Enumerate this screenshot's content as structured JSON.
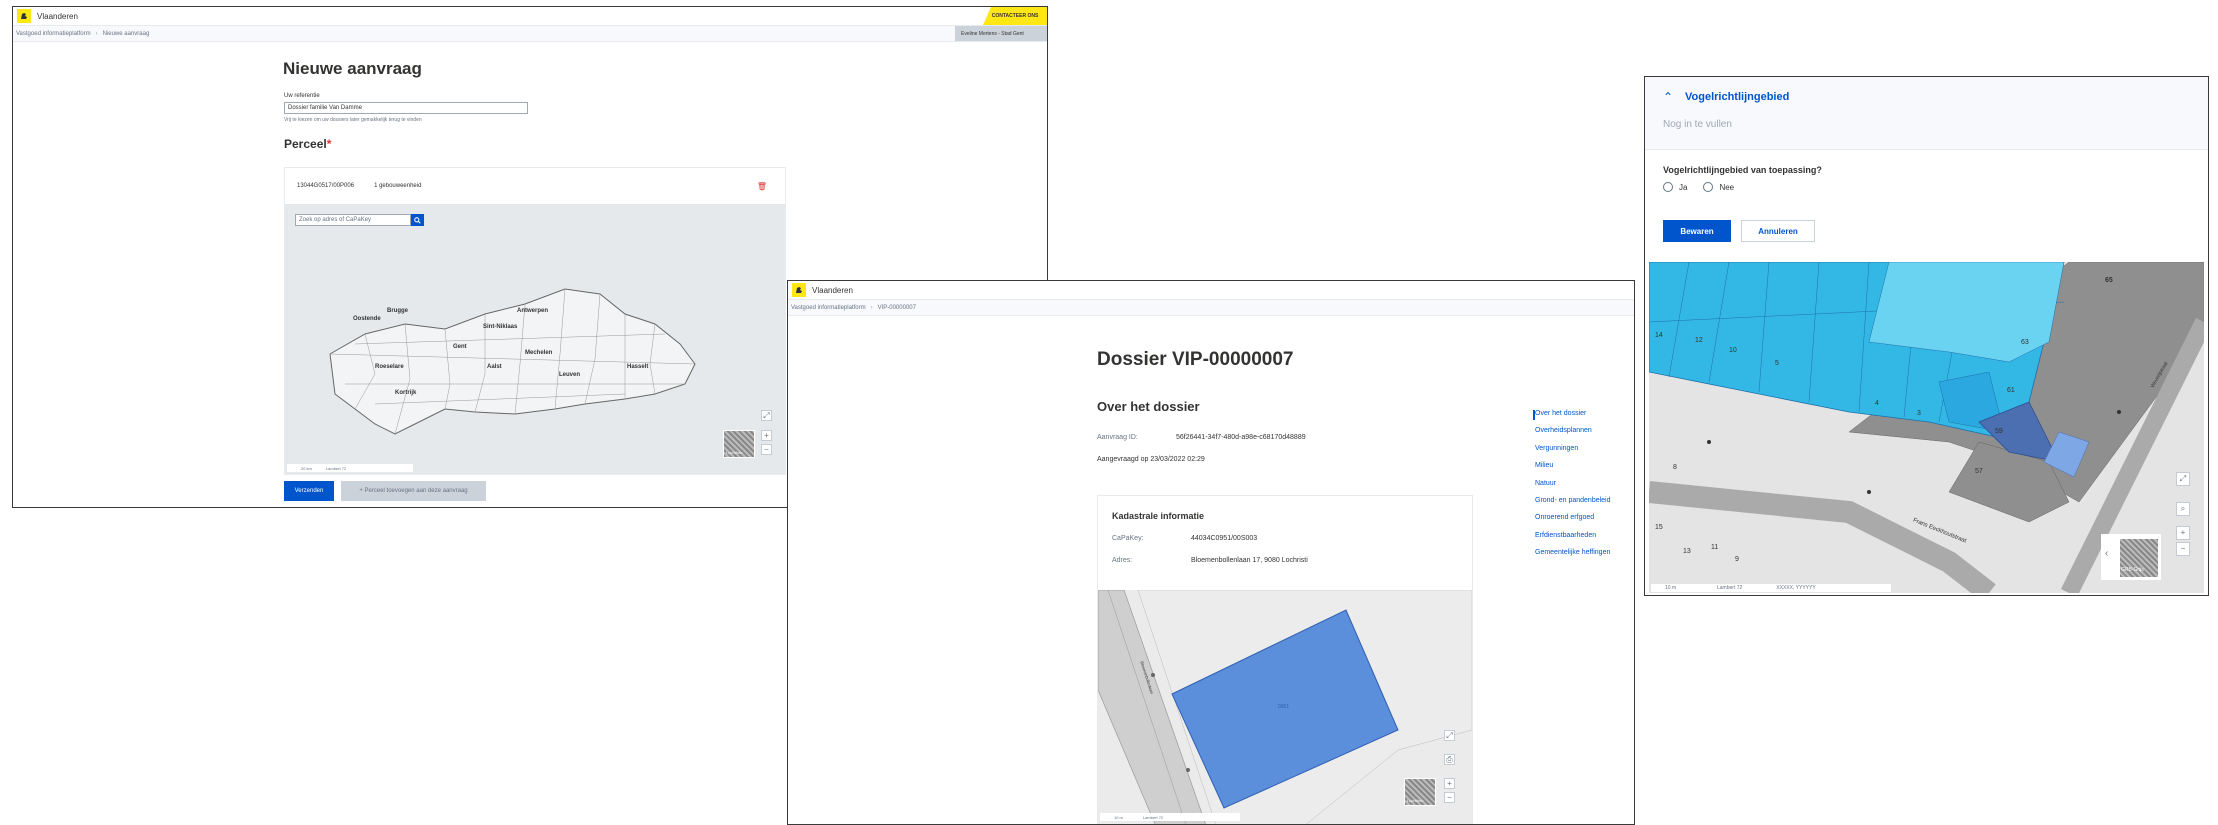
{
  "window1": {
    "brand": "Vlaanderen",
    "contact_label": "CONTACTEER ONS",
    "user_label": "Eveline Mertens - Stad Gent",
    "breadcrumb": [
      "Vastgoed informatieplatform",
      "Nieuwe aanvraag"
    ],
    "title": "Nieuwe aanvraag",
    "reference_label": "Uw referentie",
    "reference_value": "Dossier familie Van Damme",
    "reference_hint": "Vrij te kiezen om uw dossiers later gemakkelijk terug te vinden",
    "perceel_label": "Perceel",
    "perceel_required": "*",
    "parcel_id": "13044G0517/00P006",
    "parcel_units": "1 gebouweenheid",
    "search_placeholder": "Zoek op adres of CaPaKey",
    "map_cities": [
      "Oostende",
      "Brugge",
      "Gent",
      "Sint-Niklaas",
      "Antwerpen",
      "Mechelen",
      "Aalst",
      "Roeselare",
      "Kortrijk",
      "Leuven",
      "Hasselt"
    ],
    "scale_text": "20 km",
    "projection": "Lambert 72",
    "thumb_label": "Luchtfoto",
    "submit_label": "Verzenden",
    "add_parcel_label": "+ Perceel toevoegen aan deze aanvraag"
  },
  "window2": {
    "brand": "Vlaanderen",
    "breadcrumb": [
      "Vastgoed informatieplatform",
      "VIP-00000007"
    ],
    "title": "Dossier VIP-00000007",
    "section_title": "Over het dossier",
    "request_id_label": "Aanvraag ID:",
    "request_id_value": "56f26441-34f7-480d-a98e-c68170d48889",
    "requested_on": "Aangevraagd op 23/03/2022 02:29",
    "cadastral_title": "Kadastrale informatie",
    "capakey_label": "CaPaKey:",
    "capakey_value": "44034C0951/00S003",
    "address_label": "Adres:",
    "address_value": "Bloemenbollenlaan 17, 9080 Lochristi",
    "street_label": "Bloemenbollenlaan",
    "parcel_label": "0951",
    "scale_text": "10 m",
    "projection": "Lambert 72",
    "thumb_label": "Luchtfoto",
    "sidenav": [
      "Over het dossier",
      "Overheidsplannen",
      "Vergunningen",
      "Milieu",
      "Natuur",
      "Grond- en pandenbeleid",
      "Onroerend erfgoed",
      "Erfdienstbaarheden",
      "Gemeentelijke heffingen"
    ]
  },
  "window3": {
    "title": "Vogelrichtlijngebied",
    "status": "Nog in te vullen",
    "question": "Vogelrichtlijngebied van toepassing?",
    "options": [
      "Ja",
      "Nee"
    ],
    "save_label": "Bewaren",
    "cancel_label": "Annuleren",
    "map_numbers": [
      "65",
      "14",
      "12",
      "10",
      "5",
      "4",
      "3",
      "63",
      "61",
      "59",
      "57",
      "8",
      "15",
      "13",
      "11",
      "9"
    ],
    "street_label": "Frans Eeckhoutstraat",
    "street_label_2": "Weverijstraat",
    "thumb_label": "GRB-Grijs",
    "scale_text": "10 m",
    "projection": "Lambert 72",
    "coords": "XXXXX, YYYYYY"
  }
}
